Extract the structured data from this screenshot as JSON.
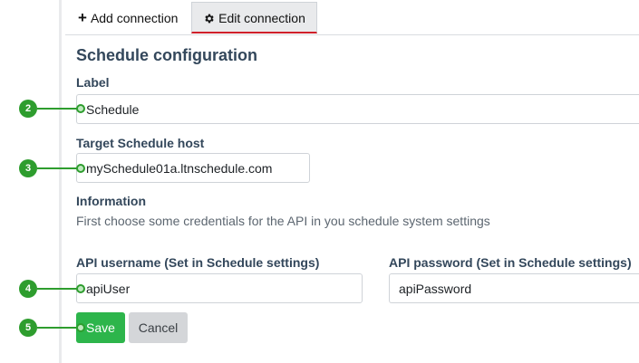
{
  "tabs": {
    "add_label": "Add connection",
    "edit_label": "Edit connection"
  },
  "form": {
    "title": "Schedule configuration",
    "label_label": "Label",
    "label_value": "Schedule",
    "host_label": "Target Schedule host",
    "host_value": "mySchedule01a.ltnschedule.com",
    "info_heading": "Information",
    "info_text": "First choose some credentials for the API in you schedule system settings",
    "username_label": "API username (Set in Schedule settings)",
    "username_value": "apiUser",
    "password_label": "API password (Set in Schedule settings)",
    "password_value": "apiPassword"
  },
  "actions": {
    "save_label": "Save",
    "cancel_label": "Cancel"
  },
  "callouts": [
    "2",
    "3",
    "4",
    "5"
  ],
  "colors": {
    "accent_green": "#2db54b",
    "callout_green": "#2e9d2e",
    "active_tab_underline": "#d0202a"
  }
}
